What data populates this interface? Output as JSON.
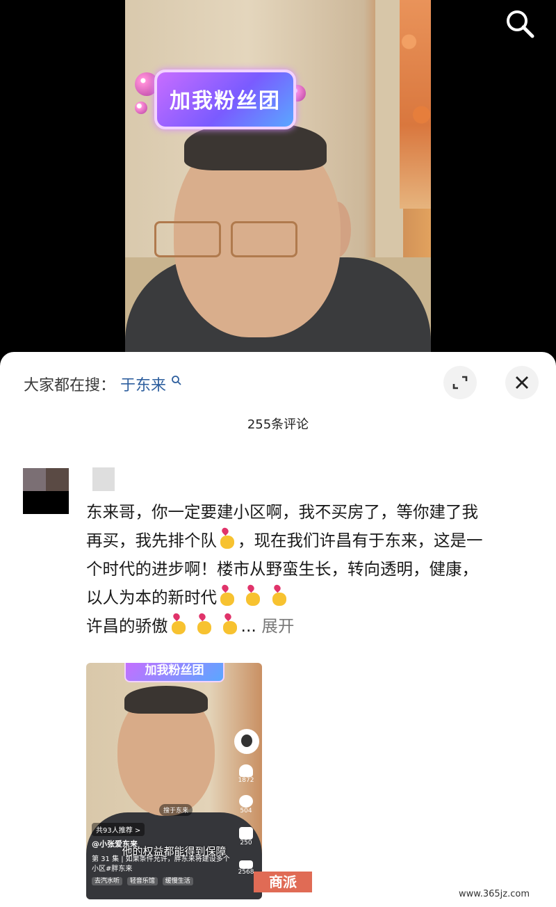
{
  "video": {
    "badge_text": "加我粉丝团",
    "search_icon": "search-icon"
  },
  "sheet": {
    "trending_label": "大家都在搜：",
    "trending_term": "于东来",
    "comment_count": "255条评论",
    "expand_icon": "fullscreen-icon",
    "close_icon": "close-icon"
  },
  "comment": {
    "line1": "东来哥，你一定要建小区啊，我不买房了，等你建了我",
    "line2a": "再买，我先排个队",
    "line2b": "，现在我们许昌有于东来，这是一",
    "line3": "个时代的进步啊！楼市从野蛮生长，转向透明，健康，",
    "line4": "以人为本的新时代",
    "line5": "许昌的骄傲",
    "ellipsis": "...",
    "expand": "展开",
    "emoji_name": "finger-heart-emoji"
  },
  "thumbnail": {
    "badge": "加我粉丝团",
    "like_count": "1872",
    "comment_count": "504",
    "favorite_count": "250",
    "share_count": "2568",
    "search_chip": "搜于东来",
    "recommend": "共93人推荐 >",
    "author": "@小张爱东来",
    "subtitle": "他的权益都能得到保障",
    "desc": "第 31 集 | 如果条件允许，胖东来将建设多个小区#胖东来",
    "tags": [
      "去汽水听",
      "轻音乐馆",
      "缓慢生活"
    ]
  },
  "watermarks": {
    "brand": "商派",
    "site": "www.365jz.com"
  }
}
